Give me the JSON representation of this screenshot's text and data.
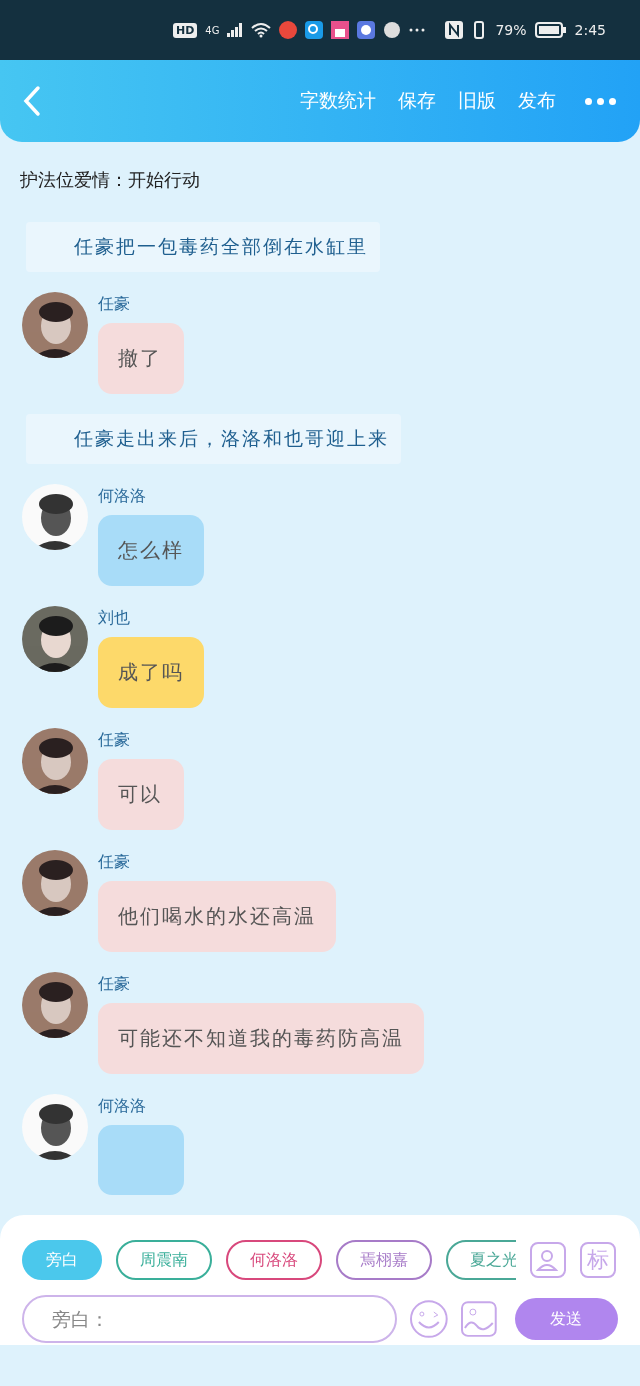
{
  "status_bar": {
    "hd": "HD",
    "network": "4G",
    "battery": "79%",
    "time": "2:45"
  },
  "header": {
    "actions": [
      "字数统计",
      "保存",
      "旧版",
      "发布"
    ]
  },
  "scene_title": "护法位爱情：开始行动",
  "messages": [
    {
      "kind": "narration",
      "text": "任豪把一包毒药全部倒在水缸里"
    },
    {
      "kind": "chat",
      "name": "任豪",
      "text": "撤了",
      "color": "#f5dcdc"
    },
    {
      "kind": "narration",
      "text": "任豪走出来后，洛洛和也哥迎上来"
    },
    {
      "kind": "chat",
      "name": "何洛洛",
      "text": "怎么样",
      "color": "#a8dcf8"
    },
    {
      "kind": "chat",
      "name": "刘也",
      "text": "成了吗",
      "color": "#fdd96a"
    },
    {
      "kind": "chat",
      "name": "任豪",
      "text": "可以",
      "color": "#f5dcdc"
    },
    {
      "kind": "chat",
      "name": "任豪",
      "text": "他们喝水的水还高温",
      "color": "#f5dcdc"
    },
    {
      "kind": "chat",
      "name": "任豪",
      "text": "可能还不知道我的毒药防高温",
      "color": "#f5dcdc"
    },
    {
      "kind": "chat",
      "name": "何洛洛",
      "color": "#a8dcf8"
    }
  ],
  "roles": [
    {
      "label": "旁白",
      "selected": true,
      "color": "#4bc8ec"
    },
    {
      "label": "周震南",
      "selected": false,
      "color": "#3aaf9a"
    },
    {
      "label": "何洛洛",
      "selected": false,
      "color": "#d8487c"
    },
    {
      "label": "焉栩嘉",
      "selected": false,
      "color": "#a77bc8"
    },
    {
      "label": "夏之光",
      "selected": false,
      "color": "#4aa897"
    }
  ],
  "tag_button": "标",
  "input": {
    "placeholder": "旁白："
  },
  "send_button": "发送"
}
